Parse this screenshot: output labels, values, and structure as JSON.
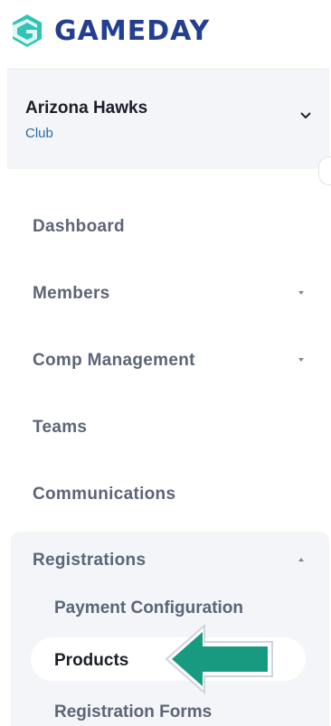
{
  "brand": {
    "name": "GAMEDAY",
    "color": "#243f8f",
    "accent": "#2ec4b6"
  },
  "org": {
    "name": "Arizona Hawks",
    "type": "Club"
  },
  "nav": {
    "dashboard": "Dashboard",
    "members": "Members",
    "comp_management": "Comp Management",
    "teams": "Teams",
    "communications": "Communications",
    "registrations": "Registrations",
    "sub": {
      "payment_configuration": "Payment Configuration",
      "products": "Products",
      "registration_forms": "Registration Forms"
    }
  },
  "annotation": {
    "arrow_color": "#179a80",
    "points_to": "Products"
  }
}
